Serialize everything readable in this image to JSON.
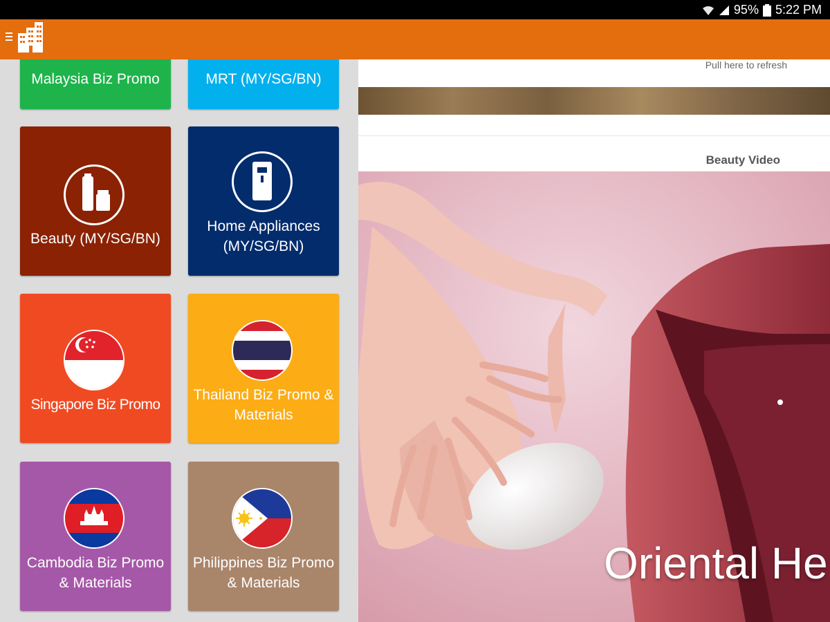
{
  "status_bar": {
    "battery": "95%",
    "time": "5:22 PM"
  },
  "app_bar": {
    "menu_icon": "menu-icon",
    "logo_icon": "building-logo-icon",
    "color": "#e46d0e"
  },
  "drawer": {
    "tiles": [
      {
        "label": "Malaysia Biz Promo",
        "color": "#1eb44b"
      },
      {
        "label": "MRT (MY/SG/BN)",
        "color": "#03b0ee"
      },
      {
        "label": "Beauty (MY/SG/BN)",
        "color": "#8b2203",
        "icon": "cosmetics-icon"
      },
      {
        "label": "Home Appliances (MY/SG/BN)",
        "color": "#032c6c",
        "icon": "water-dispenser-icon"
      },
      {
        "label": "Singapore Biz Promo",
        "color": "#f04a22",
        "icon": "singapore-flag-icon"
      },
      {
        "label": "Thailand Biz Promo & Materials",
        "color": "#fcac14",
        "icon": "thailand-flag-icon"
      },
      {
        "label": "Cambodia Biz Promo & Materials",
        "color": "#a658a8",
        "icon": "cambodia-flag-icon"
      },
      {
        "label": "Philippines Biz Promo & Materials",
        "color": "#a9856a",
        "icon": "philippines-flag-icon"
      }
    ]
  },
  "main": {
    "refresh_hint": "Pull here to refresh",
    "section_title": "Beauty Video",
    "video_caption": "Oriental He"
  }
}
